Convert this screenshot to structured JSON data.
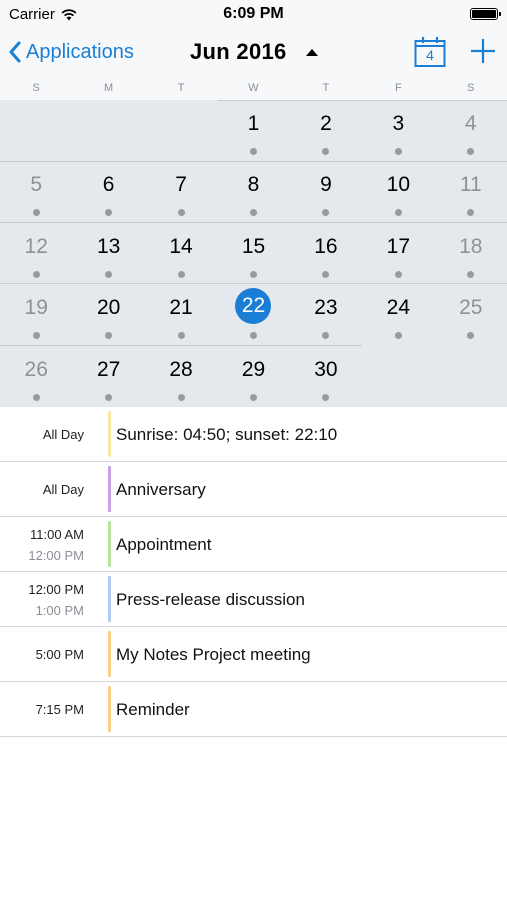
{
  "status_bar": {
    "carrier": "Carrier",
    "time": "6:09 PM"
  },
  "nav": {
    "back_label": "Applications",
    "month_title": "Jun 2016",
    "today_day": "4"
  },
  "weekdays": [
    "S",
    "M",
    "T",
    "W",
    "T",
    "F",
    "S"
  ],
  "weeks": [
    [
      {
        "d": "",
        "other": false,
        "dot": false
      },
      {
        "d": "",
        "other": false,
        "dot": false
      },
      {
        "d": "",
        "other": false,
        "dot": false
      },
      {
        "d": "1",
        "other": false,
        "dot": true
      },
      {
        "d": "2",
        "other": false,
        "dot": true
      },
      {
        "d": "3",
        "other": false,
        "dot": true
      },
      {
        "d": "4",
        "other": true,
        "dot": true
      }
    ],
    [
      {
        "d": "5",
        "other": true,
        "dot": true
      },
      {
        "d": "6",
        "other": false,
        "dot": true
      },
      {
        "d": "7",
        "other": false,
        "dot": true
      },
      {
        "d": "8",
        "other": false,
        "dot": true
      },
      {
        "d": "9",
        "other": false,
        "dot": true
      },
      {
        "d": "10",
        "other": false,
        "dot": true
      },
      {
        "d": "11",
        "other": true,
        "dot": true
      }
    ],
    [
      {
        "d": "12",
        "other": true,
        "dot": true
      },
      {
        "d": "13",
        "other": false,
        "dot": true
      },
      {
        "d": "14",
        "other": false,
        "dot": true
      },
      {
        "d": "15",
        "other": false,
        "dot": true
      },
      {
        "d": "16",
        "other": false,
        "dot": true
      },
      {
        "d": "17",
        "other": false,
        "dot": true
      },
      {
        "d": "18",
        "other": true,
        "dot": true
      }
    ],
    [
      {
        "d": "19",
        "other": true,
        "dot": true
      },
      {
        "d": "20",
        "other": false,
        "dot": true
      },
      {
        "d": "21",
        "other": false,
        "dot": true
      },
      {
        "d": "22",
        "other": false,
        "dot": true,
        "selected": true
      },
      {
        "d": "23",
        "other": false,
        "dot": true
      },
      {
        "d": "24",
        "other": false,
        "dot": true
      },
      {
        "d": "25",
        "other": true,
        "dot": true
      }
    ],
    [
      {
        "d": "26",
        "other": true,
        "dot": true
      },
      {
        "d": "27",
        "other": false,
        "dot": true
      },
      {
        "d": "28",
        "other": false,
        "dot": true
      },
      {
        "d": "29",
        "other": false,
        "dot": true
      },
      {
        "d": "30",
        "other": false,
        "dot": true
      },
      {
        "d": "",
        "other": false,
        "dot": false
      },
      {
        "d": "",
        "other": false,
        "dot": false
      }
    ]
  ],
  "events": [
    {
      "time1": "All Day",
      "time2": "",
      "title": "Sunrise: 04:50; sunset: 22:10",
      "color": "#f6e7a8"
    },
    {
      "time1": "All Day",
      "time2": "",
      "title": "Anniversary",
      "color": "#c9a3e6"
    },
    {
      "time1": "11:00 AM",
      "time2": "12:00 PM",
      "title": "Appointment",
      "color": "#b7e6a0"
    },
    {
      "time1": "12:00 PM",
      "time2": "1:00 PM",
      "title": "Press-release discussion",
      "color": "#aecbf2"
    },
    {
      "time1": "5:00 PM",
      "time2": "",
      "title": "My Notes Project meeting",
      "color": "#f7cf87"
    },
    {
      "time1": "7:15 PM",
      "time2": "",
      "title": "Reminder",
      "color": "#f7cf87"
    }
  ],
  "colors": {
    "accent": "#1a7fd4",
    "grid_bg": "#e5e8ec"
  }
}
